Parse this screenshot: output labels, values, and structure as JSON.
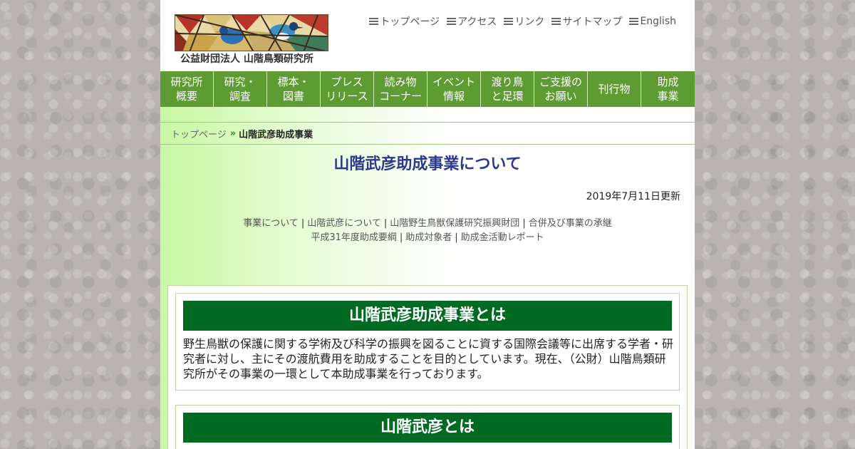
{
  "header": {
    "org_name": "公益財団法人 山階鳥類研究所",
    "logo_icon": "stained-glass-birds-logo"
  },
  "util_nav": [
    {
      "label": "トップページ",
      "icon": "menu-icon"
    },
    {
      "label": "アクセス",
      "icon": "menu-icon"
    },
    {
      "label": "リンク",
      "icon": "menu-icon"
    },
    {
      "label": "サイトマップ",
      "icon": "menu-icon"
    },
    {
      "label": "English",
      "icon": "menu-icon"
    }
  ],
  "global_nav": [
    {
      "line1": "研究所",
      "line2": "概要"
    },
    {
      "line1": "研究・",
      "line2": "調査"
    },
    {
      "line1": "標本・",
      "line2": "図書"
    },
    {
      "line1": "プレス",
      "line2": "リリース"
    },
    {
      "line1": "読み物",
      "line2": "コーナー"
    },
    {
      "line1": "イベント",
      "line2": "情報"
    },
    {
      "line1": "渡り鳥",
      "line2": "と足環"
    },
    {
      "line1": "ご支援の",
      "line2": "お願い"
    },
    {
      "line1": "刊行物",
      "line2": ""
    },
    {
      "line1": "助成",
      "line2": "事業"
    }
  ],
  "breadcrumb": {
    "home": "トップページ",
    "separator": "»",
    "current": "山階武彦助成事業"
  },
  "page": {
    "title": "山階武彦助成事業について",
    "updated": "2019年7月11日更新"
  },
  "subnav": {
    "row1": [
      "事業について",
      "山階武彦について",
      "山階野生鳥獣保護研究振興財団",
      "合併及び事業の承継"
    ],
    "row2": [
      "平成31年度助成要綱",
      "助成対象者",
      "助成金活動レポート"
    ],
    "separator": "|"
  },
  "sections": [
    {
      "heading": "山階武彦助成事業とは",
      "body": "野生鳥獣の保護に関する学術及び科学の振興を図ることに資する国際会議等に出席する学者・研究者に対し、主にその渡航費用を助成することを目的としています。現在、（公財）山階鳥類研究所がその事業の一環として本助成事業を行っております。"
    },
    {
      "heading": "山階武彦とは",
      "body": ""
    }
  ],
  "colors": {
    "nav_green": "#5e9b32",
    "heading_green": "#006a23",
    "title_blue": "#2b3a8c"
  }
}
